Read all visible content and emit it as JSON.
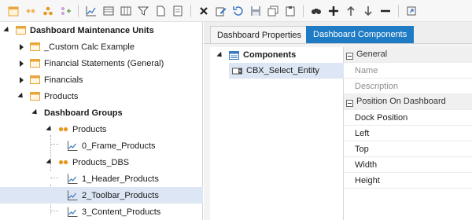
{
  "toolbar": {
    "icons": [
      "new-dashboard-icon",
      "new-group-icon",
      "new-component-icon",
      "add-item-icon",
      "chart-icon",
      "grid-icon",
      "table-icon",
      "filter-icon",
      "document-icon",
      "report-icon",
      "delete-icon",
      "edit-icon",
      "revert-icon",
      "save-icon",
      "copy-icon",
      "clipboard-icon",
      "search-icon",
      "add-icon",
      "move-up-icon",
      "move-down-icon",
      "remove-icon",
      "navigate-icon"
    ]
  },
  "tree": {
    "root_label": "Dashboard Maintenance Units",
    "items": [
      {
        "label": "_Custom Calc Example"
      },
      {
        "label": "Financial Statements (General)"
      },
      {
        "label": "Financials"
      },
      {
        "label": "Products"
      },
      {
        "label": "Dashboard Groups"
      },
      {
        "label": "Products"
      },
      {
        "label": "0_Frame_Products"
      },
      {
        "label": "Products_DBS"
      },
      {
        "label": "1_Header_Products"
      },
      {
        "label": "2_Toolbar_Products"
      },
      {
        "label": "3_Content_Products"
      }
    ]
  },
  "tabs": [
    {
      "label": "Dashboard Properties"
    },
    {
      "label": "Dashboard Components"
    }
  ],
  "components": {
    "header": "Components",
    "items": [
      {
        "label": "CBX_Select_Entity"
      }
    ]
  },
  "properties": {
    "general_label": "General",
    "general_items": [
      "Name",
      "Description"
    ],
    "position_label": "Position On Dashboard",
    "position_items": [
      "Dock Position",
      "Left",
      "Top",
      "Width",
      "Height"
    ]
  },
  "colors": {
    "accent": "#1f7cc4",
    "selection": "#dce6f4",
    "folder": "#e8a53a",
    "group_dots": "#e89a1e"
  }
}
